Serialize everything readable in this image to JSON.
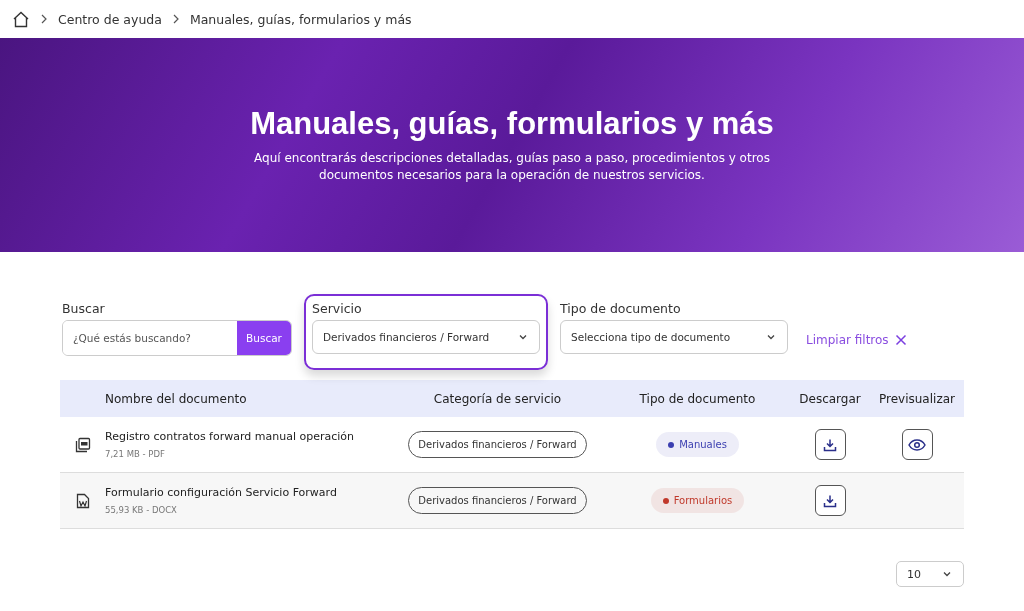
{
  "breadcrumb": [
    "Centro de ayuda",
    "Manuales, guías, formularios y más"
  ],
  "banner": {
    "title": "Manuales, guías, formularios y más",
    "subtitle": "Aquí encontrarás descripciones detalladas, guías paso a paso, procedimientos y otros documentos necesarios para la operación de nuestros servicios."
  },
  "search": {
    "label": "Buscar",
    "placeholder": "¿Qué estás buscando?",
    "button": "Buscar"
  },
  "filters": [
    {
      "label": "Servicio",
      "value": "Derivados financieros / Forward",
      "focused": true
    },
    {
      "label": "Tipo de documento",
      "value": "Selecciona tipo de documento",
      "focused": false
    }
  ],
  "clear_filters": "Limpiar filtros",
  "table": {
    "columns": [
      "Nombre del documento",
      "Categoría de servicio",
      "Tipo de documento",
      "Descargar",
      "Previsualizar"
    ],
    "rows": [
      {
        "kind": "pdf",
        "name": "Registro contratos forward manual operación",
        "meta": "7,21 MB - PDF",
        "category": "Derivados financieros / Forward",
        "type": "Manuales",
        "color": "#3b3fb0",
        "previewable": true
      },
      {
        "kind": "docx",
        "name": "Formulario configuración Servicio Forward",
        "meta": "55,93 KB - DOCX",
        "category": "Derivados financieros / Forward",
        "type": "Formularios",
        "color": "#c0392b",
        "previewable": false
      }
    ]
  },
  "page_size": "10"
}
